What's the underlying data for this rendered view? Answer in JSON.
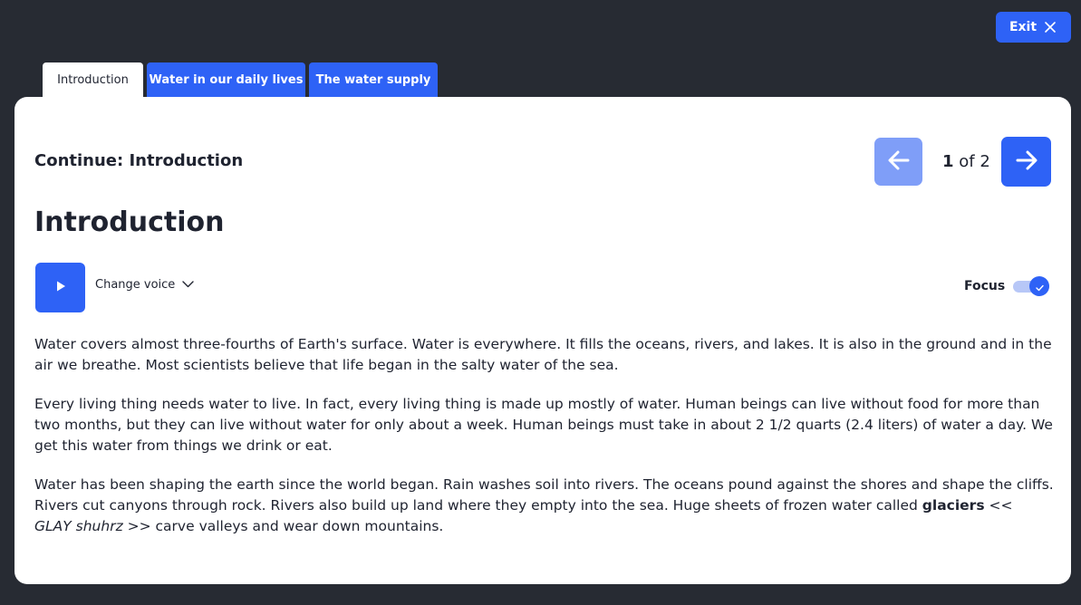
{
  "header": {
    "exit_label": "Exit"
  },
  "tabs": [
    {
      "label": "Introduction",
      "active": true
    },
    {
      "label": "Water in our daily lives",
      "active": false
    },
    {
      "label": "The water supply",
      "active": false
    }
  ],
  "lesson": {
    "continue_title": "Continue: Introduction",
    "pager": {
      "current": "1",
      "of_total": "of 2"
    },
    "heading": "Introduction",
    "audio": {
      "change_voice_label": "Change voice"
    },
    "focus": {
      "label": "Focus",
      "enabled": true
    },
    "paragraphs": [
      "Water covers almost three-fourths of Earth's surface. Water is everywhere. It fills the oceans, rivers, and lakes. It is also in the ground and in the air we breathe. Most scientists believe that life began in the salty water of the sea.",
      "Every living thing needs water to live. In fact, every living thing is made up mostly of water. Human beings can live without food for more than two months, but they can live without water for only about a week. Human beings must take in about 2 1/2 quarts (2.4 liters) of water a day. We get this water from things we drink or eat."
    ],
    "paragraph3": {
      "before": "Water has been shaping the earth since the world began. Rain washes soil into rivers. The oceans pound against the shores and shape the cliffs. Rivers cut canyons through rock. Rivers also build up land where they empty into the sea. Huge sheets of frozen water called ",
      "term": "glaciers",
      "pronunciation": "<< GLAY shuhrz >>",
      "after": " carve valleys and wear down mountains."
    }
  },
  "icons": {
    "exit": "close-icon",
    "prev": "arrow-left-icon",
    "next": "arrow-right-icon",
    "play": "play-icon",
    "voice_dropdown": "chevron-down-icon",
    "focus_check": "check-icon"
  },
  "colors": {
    "background": "#272b33",
    "accent": "#2e62f6",
    "accent_disabled": "#7f9ef8",
    "card": "#ffffff",
    "text": "#1f2330"
  }
}
